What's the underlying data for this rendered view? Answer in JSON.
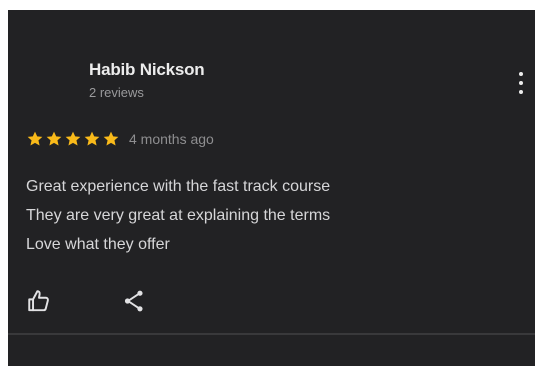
{
  "review": {
    "reviewer_name": "Habib Nickson",
    "reviewer_meta": "2 reviews",
    "rating": 5,
    "rating_max": 5,
    "date": "4 months ago",
    "text_lines": [
      "Great experience with the fast track course",
      "They are very great at explaining the terms",
      "Love what they offer"
    ]
  },
  "icons": {
    "menu": "more-vert-icon",
    "star": "star-icon",
    "like": "thumb-up-icon",
    "share": "share-icon"
  },
  "colors": {
    "card_background": "#222224",
    "star": "#f9ba1a",
    "primary_text": "#ececec",
    "secondary_text": "#9a9a9c"
  }
}
